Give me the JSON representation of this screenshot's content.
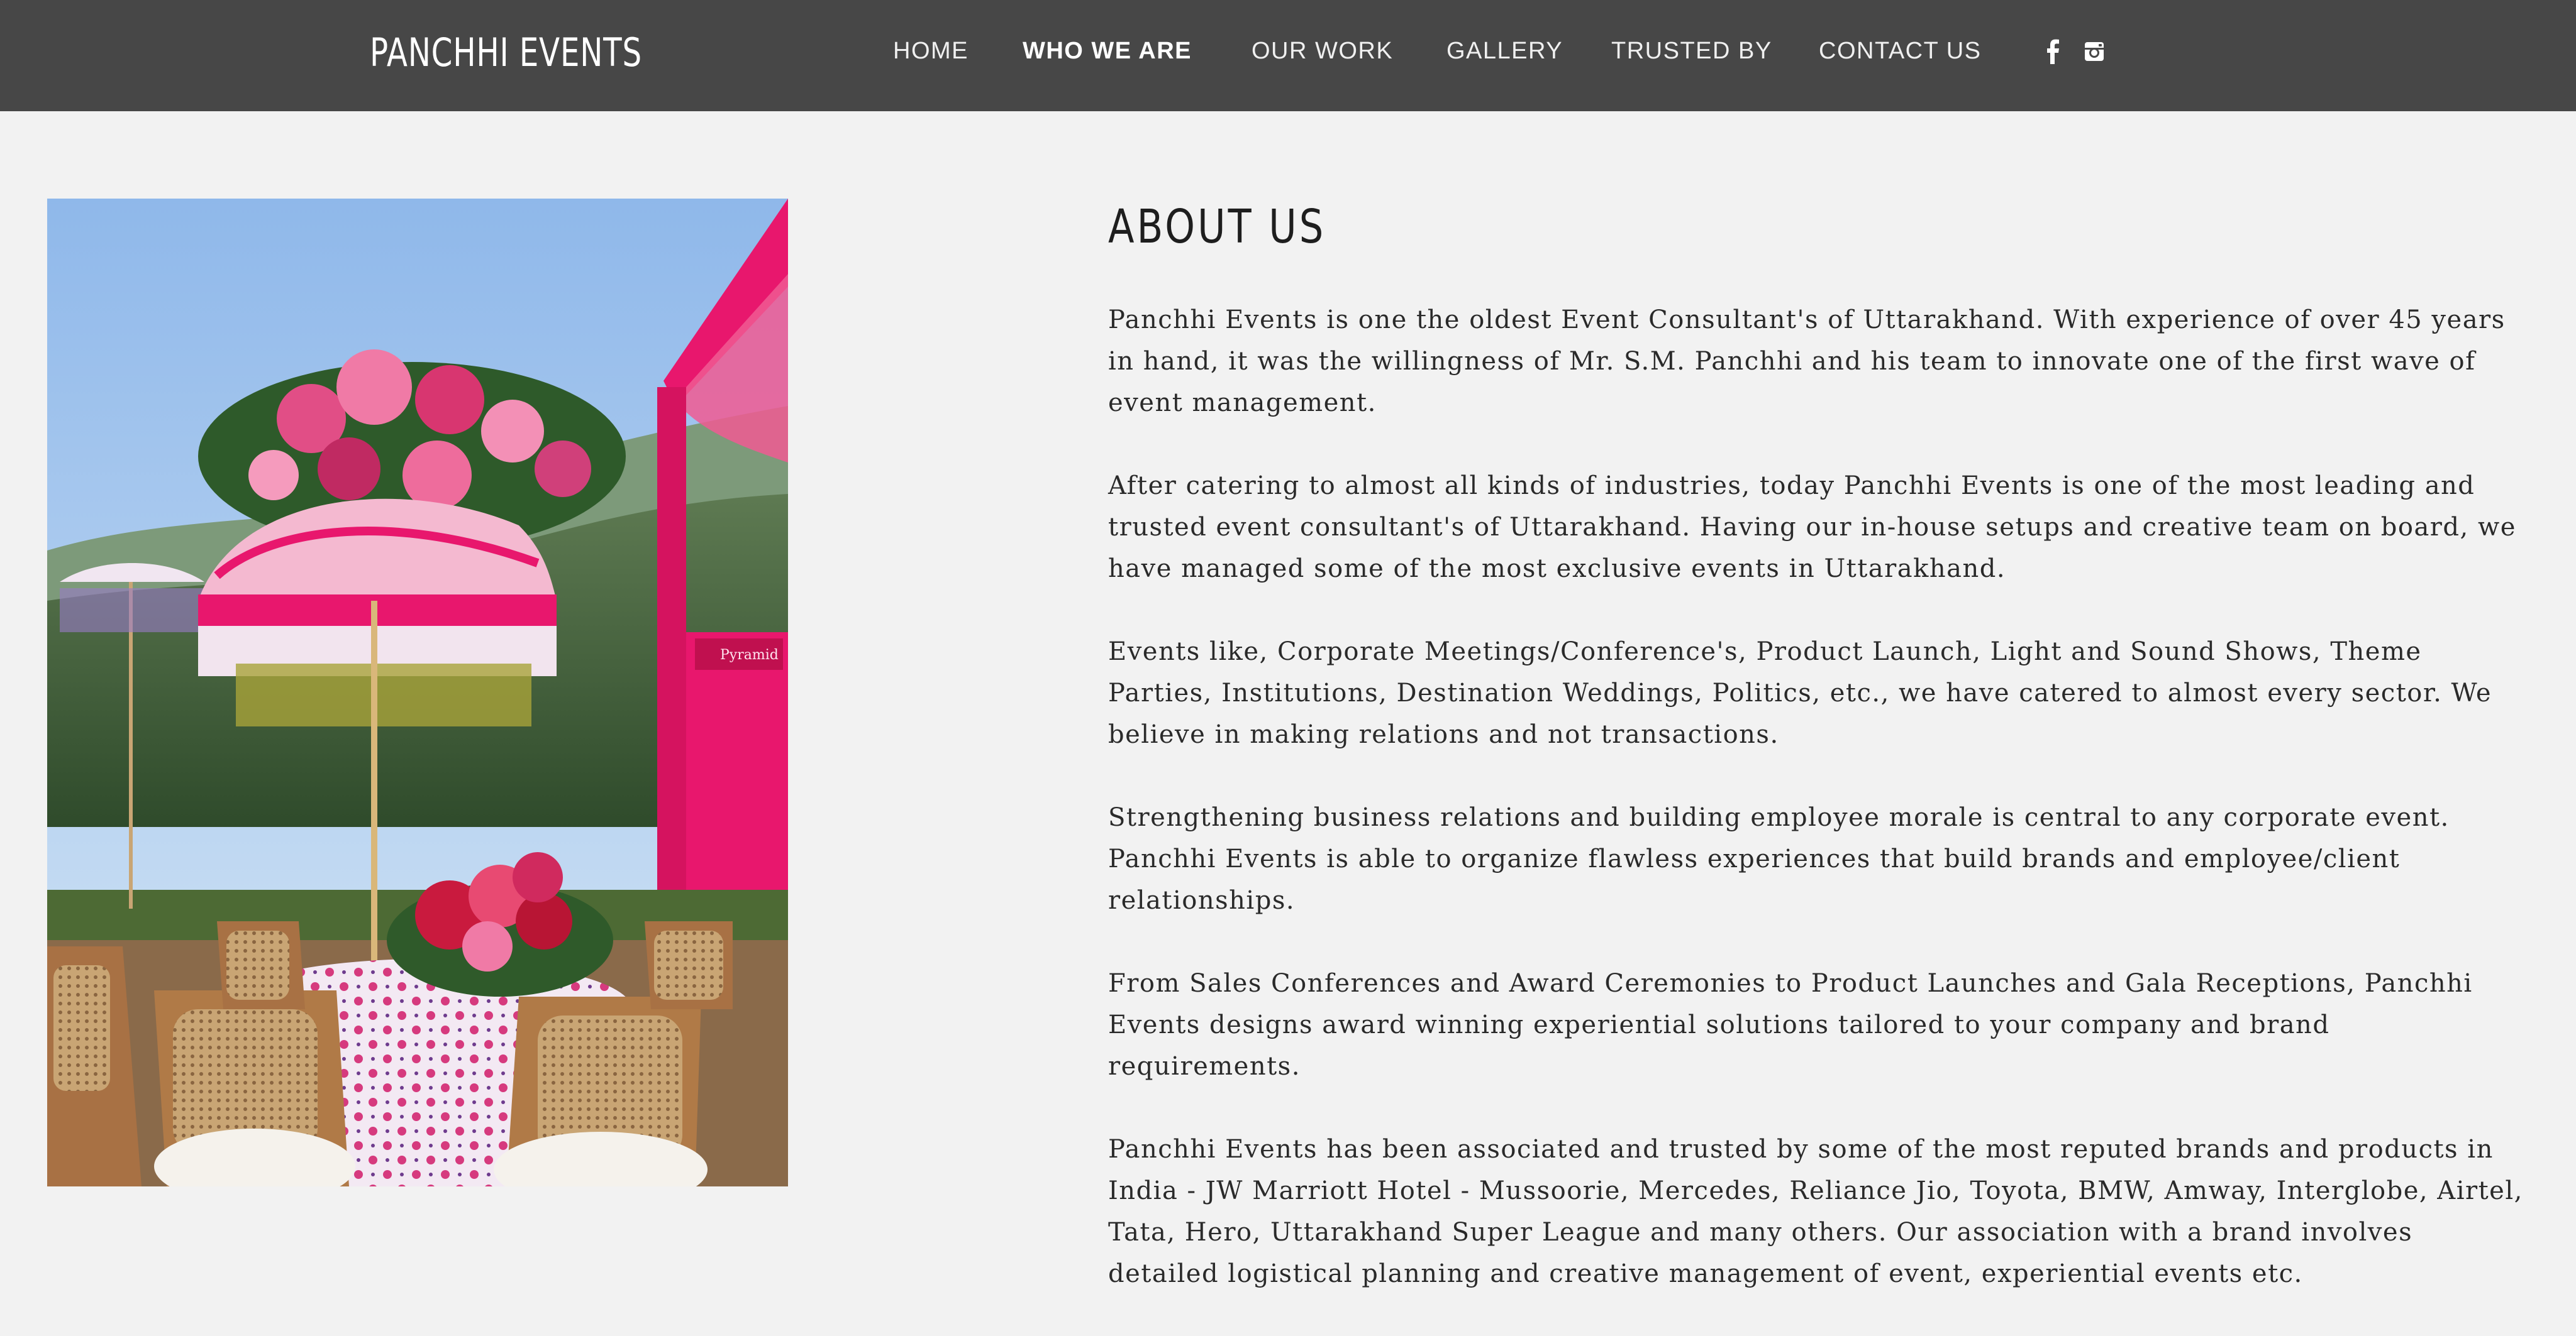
{
  "header": {
    "brand": "PANCHHI EVENTS",
    "nav": [
      {
        "label": "HOME",
        "active": false
      },
      {
        "label": "WHO WE ARE",
        "active": true
      },
      {
        "label": "OUR WORK",
        "active": false
      },
      {
        "label": "GALLERY",
        "active": false
      },
      {
        "label": "TRUSTED BY",
        "active": false
      },
      {
        "label": "CONTACT US",
        "active": false
      }
    ],
    "social": [
      {
        "icon": "facebook-icon"
      },
      {
        "icon": "instagram-icon"
      }
    ]
  },
  "photo": {
    "icon": "event-table-setup-image",
    "sign_text": "Pyramid"
  },
  "about": {
    "title": "ABOUT US",
    "paragraphs": [
      "Panchhi Events is one the oldest Event Consultant's of Uttarakhand. With experience of over 45 years in hand, it was the willingness of Mr. S.M. Panchhi and his team to innovate one of the first wave of event management.",
      "After catering to almost all kinds of industries, today Panchhi Events is one of the most leading and trusted event consultant's of Uttarakhand. Having our in-house setups and creative team on board, we have managed some of the most exclusive events in Uttarakhand.",
      "Events like, Corporate Meetings/Conference's, Product Launch, Light and Sound Shows, Theme Parties, Institutions, Destination Weddings, Politics, etc., we have catered to almost every sector. We believe in making relations and not transactions.",
      "Strengthening business relations and building employee morale is central to any corporate event. Panchhi Events is able to organize flawless experiences that build brands and employee/client relationships.",
      "From Sales Conferences and Award Ceremonies to Product Launches and Gala Receptions, Panchhi Events designs award winning experiential solutions tailored to your company and brand requirements.",
      "Panchhi Events has been associated and trusted by some of the most reputed brands and products in India - JW Marriott Hotel - Mussoorie, Mercedes, Reliance Jio, Toyota, BMW, Amway, Interglobe, Airtel, Tata, Hero, Uttarakhand Super League and many others. Our association with a brand involves detailed logistical planning and creative management of event, experiential events etc."
    ]
  },
  "colors": {
    "header_bg": "#474747",
    "page_bg": "#f2f2f2",
    "accent_pink": "#e8176d"
  }
}
